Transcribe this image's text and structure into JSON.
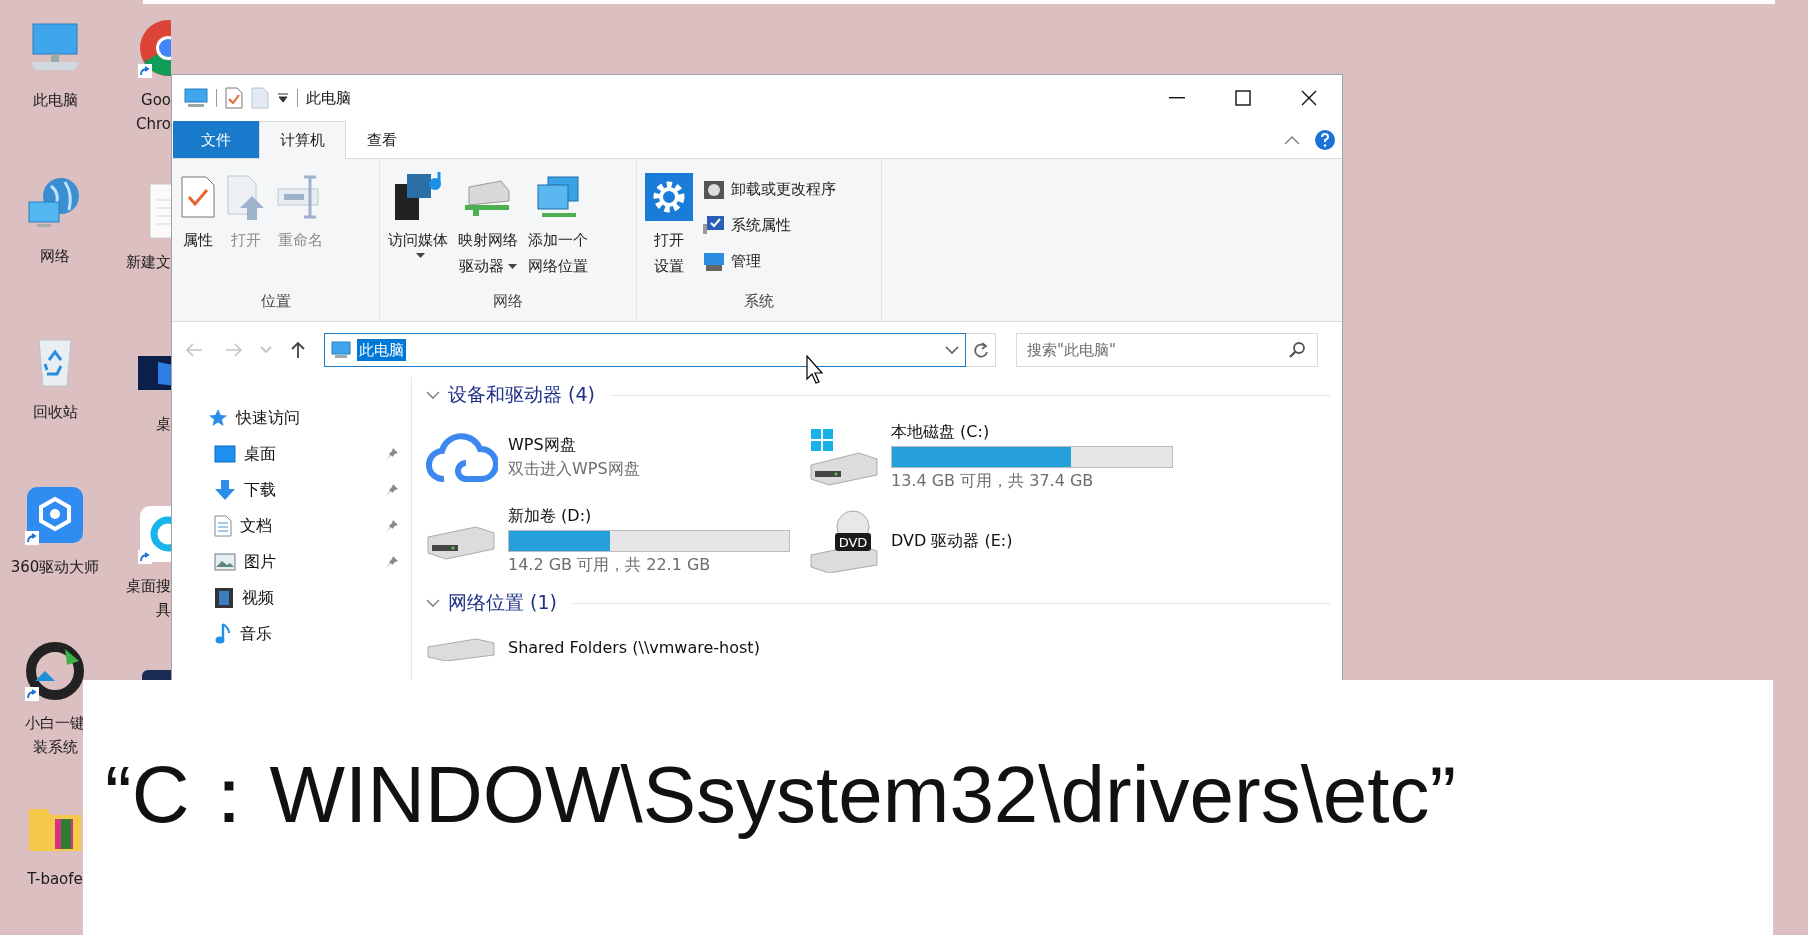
{
  "desktop": {
    "columns": [
      [
        {
          "kind": "computer",
          "label": [
            "此电脑"
          ],
          "shortcut": false
        },
        {
          "kind": "network",
          "label": [
            "网络"
          ],
          "shortcut": false
        },
        {
          "kind": "recycle",
          "label": [
            "回收站"
          ],
          "shortcut": false
        },
        {
          "kind": "driver",
          "label": [
            "360驱动大师"
          ],
          "shortcut": true
        },
        {
          "kind": "installer",
          "label": [
            "小白一键",
            "装系统"
          ],
          "shortcut": true
        },
        {
          "kind": "folder",
          "label": [
            "T-baofe"
          ],
          "shortcut": false
        }
      ],
      [
        {
          "kind": "browser",
          "label": [
            "Goo",
            "Chro"
          ],
          "shortcut": true
        },
        {
          "kind": "document",
          "label": [
            "新建文"
          ],
          "shortcut": false
        },
        {
          "kind": "wallpaper",
          "label": [
            "桌"
          ],
          "shortcut": false
        },
        {
          "kind": "search-tool",
          "label": [
            "桌面搜",
            "具"
          ],
          "shortcut": true
        },
        {
          "kind": "app",
          "shortcut": false
        }
      ]
    ]
  },
  "window": {
    "title": "此电脑"
  },
  "ribbon": {
    "tabs": [
      {
        "label": "文件",
        "kind": "file",
        "selected": false
      },
      {
        "label": "计算机",
        "kind": "tab",
        "selected": true
      },
      {
        "label": "查看",
        "kind": "tab",
        "selected": false
      }
    ],
    "groups": [
      {
        "label": "位置",
        "buttons": [
          {
            "kind": "large",
            "label": [
              "属性"
            ],
            "disabled": false,
            "dropdown": false
          },
          {
            "kind": "large",
            "label": [
              "打开"
            ],
            "disabled": true,
            "dropdown": false
          },
          {
            "kind": "large",
            "label": [
              "重命名"
            ],
            "disabled": true,
            "dropdown": false
          }
        ]
      },
      {
        "label": "网络",
        "buttons": [
          {
            "kind": "large",
            "label": [
              "访问媒体"
            ],
            "disabled": false,
            "dropdown": true
          },
          {
            "kind": "large",
            "label": [
              "映射网络",
              "驱动器"
            ],
            "disabled": false,
            "dropdown": true
          },
          {
            "kind": "large",
            "label": [
              "添加一个",
              "网络位置"
            ],
            "disabled": false,
            "dropdown": false
          }
        ]
      },
      {
        "label": "系统",
        "buttons": [
          {
            "kind": "large",
            "label": [
              "打开",
              "设置"
            ],
            "disabled": false,
            "dropdown": false
          },
          {
            "kind": "small",
            "label": [
              "卸载或更改程序"
            ],
            "disabled": false,
            "dropdown": false
          },
          {
            "kind": "small",
            "label": [
              "系统属性"
            ],
            "disabled": false,
            "dropdown": false
          },
          {
            "kind": "small",
            "label": [
              "管理"
            ],
            "disabled": false,
            "dropdown": false
          }
        ]
      }
    ]
  },
  "address_bar": {
    "history": [
      {
        "kind": "back",
        "disabled": true
      },
      {
        "kind": "forward",
        "disabled": true
      },
      {
        "kind": "recent",
        "disabled": true
      },
      {
        "kind": "up",
        "disabled": false
      }
    ],
    "path": "此电脑",
    "selected": true,
    "search_placeholder": "搜索\"此电脑\""
  },
  "navigation": {
    "items": [
      {
        "kind": "quick-access",
        "label": "快速访问",
        "pinned": false
      },
      {
        "kind": "desktop",
        "label": "桌面",
        "pinned": true
      },
      {
        "kind": "downloads",
        "label": "下载",
        "pinned": true
      },
      {
        "kind": "documents",
        "label": "文档",
        "pinned": true
      },
      {
        "kind": "pictures",
        "label": "图片",
        "pinned": true
      },
      {
        "kind": "videos",
        "label": "视频",
        "pinned": false
      },
      {
        "kind": "music",
        "label": "音乐",
        "pinned": false
      }
    ]
  },
  "sections": [
    {
      "title": "设备和驱动器 (4)",
      "expanded": true,
      "items": [
        {
          "kind": "cloud",
          "name": "WPS网盘",
          "subtitle": "双击进入WPS网盘"
        },
        {
          "kind": "system-drive",
          "name": "本地磁盘 (C:)",
          "level": 0.64,
          "reading": "13.4 GB 可用，共 37.4 GB"
        },
        {
          "kind": "drive",
          "name": "新加卷 (D:)",
          "level": 0.36,
          "reading": "14.2 GB 可用，共 22.1 GB"
        },
        {
          "kind": "dvd",
          "name": "DVD 驱动器 (E:)",
          "badge": "DVD"
        }
      ]
    },
    {
      "title": "网络位置 (1)",
      "expanded": true,
      "items": [
        {
          "kind": "share",
          "name": "Shared Folders (\\\\vmware-host)"
        }
      ]
    }
  ],
  "caption": "“C：WINDOW\\Ssystem32\\drivers\\etc”"
}
